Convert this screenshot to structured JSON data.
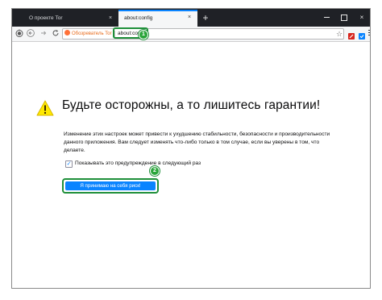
{
  "browser": {
    "tabs": [
      {
        "label": "О проекте Tor",
        "close": "×",
        "active": false
      },
      {
        "label": "about:config",
        "close": "×",
        "active": true
      }
    ],
    "new_tab": "+",
    "window_controls": {
      "close": "×"
    },
    "nav": {
      "identity_label": "Обозреватель Tor",
      "url": "about:config",
      "bookmark_star": "☆"
    },
    "icons": [
      "onion-icon",
      "back-arrow-icon",
      "forward-arrow-icon",
      "reload-icon",
      "firefox-icon",
      "star-icon",
      "extension-icon",
      "tor-button-icon",
      "hamburger-menu-icon",
      "warning-icon"
    ]
  },
  "page": {
    "title": "Будьте осторожны, а то лишитесь гарантии!",
    "description": "Изменение этих настроек может привести к ухудшению стабильности, безопасности и производительности данного приложения. Вам следует изменять что-либо только в том случае, если вы уверены в том, что делаете.",
    "checkbox_label": "Показывать это предупреждение в следующий раз",
    "checkbox_checked": true,
    "checkbox_mark": "✓",
    "accept_button": "Я принимаю на себя риск!"
  },
  "annotations": {
    "badge_1": "1",
    "badge_2": "2"
  },
  "colors": {
    "tab_strip": "#1f2126",
    "accent": "#0a84ff",
    "highlight": "#1f8f3a",
    "warning": "#ffe900"
  }
}
